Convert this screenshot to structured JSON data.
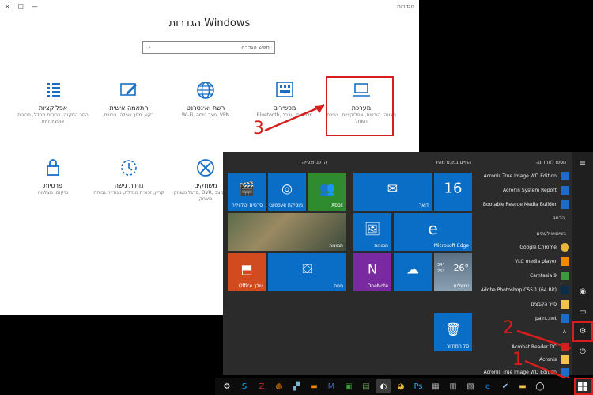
{
  "settings": {
    "window_title": "הגדרות",
    "page_title": "הגדרות Windows",
    "search_placeholder": "חפש הגדרה",
    "tiles": [
      {
        "title": "מערכת",
        "desc": "תצוגה, הודעות, אפליקציות, צריכת חשמל"
      },
      {
        "title": "מכשירים",
        "desc": "Bluetooth, מדפסות, עכבר"
      },
      {
        "title": "רשת ואינטרנט",
        "desc": "Wi-Fi, מצב טיסה, VPN"
      },
      {
        "title": "התאמה אישית",
        "desc": "רקע, מסך נעילה, צבעים"
      },
      {
        "title": "אפליקציות",
        "desc": "הסר התקנה, ברירות מחדל, תכונות אופציונליות"
      },
      {
        "title": "משחקים",
        "desc": "סרגל משחק, DVR, שידור, מצב משחק"
      },
      {
        "title": "נוחות גישה",
        "desc": "קריין, זכוכית מגדלת, ניגודיות גבוהה"
      },
      {
        "title": "פרטיות",
        "desc": "מיקום, מצלמה"
      }
    ]
  },
  "annotations": {
    "one": "1",
    "two": "2",
    "three": "3"
  },
  "start": {
    "group_play": "הרכב וצפייה",
    "group_life": "החיים במבט מהיר",
    "recent_header": "נוספו לאחרונה",
    "expand": "הרחב",
    "most_used": "בשימוש לעתים",
    "tiles": {
      "movies": "סרטים וטלוויזיה",
      "groove": "Groove מוסיקת",
      "xbox": "Xbox",
      "photos": "תמונות",
      "office": "Office שלך",
      "store": "חנות",
      "mail": "דואר",
      "calendar_day": "16",
      "edge": "Microsoft Edge",
      "onenote": "OneNote",
      "skype": "",
      "weather_temp": "26°",
      "weather_hi": "34°",
      "weather_lo": "25°",
      "weather_city": "ירושלים",
      "news": "חדשות",
      "recycle": "סל המחזור"
    },
    "recent_apps": [
      "Acronis True Image WD Edition",
      "Acronis System Report",
      "Bootable Rescue Media Builder"
    ],
    "apps": [
      "Google Chrome",
      "VLC media player",
      "Camtasia 9",
      "Adobe Photoshop CS5.1 (64 Bit)",
      "סייר הקבצים",
      "paint.net",
      "Acrobat Reader DC",
      "Acronis",
      "Acronis True Image WD Edition"
    ],
    "letter_a": "A"
  }
}
